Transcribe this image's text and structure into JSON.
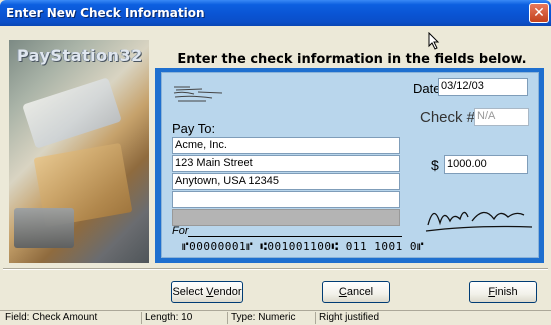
{
  "window": {
    "title": "Enter New Check Information",
    "close_glyph": "✕"
  },
  "branding": {
    "logo_text": "PayStation32"
  },
  "instruction": "Enter the check information in the fields below.",
  "check": {
    "date_label": "Date",
    "date_value": "03/12/03",
    "check_no_label": "Check #",
    "check_no_placeholder": "N/A",
    "pay_to_label": "Pay To:",
    "address_lines": [
      "Acme, Inc.",
      "123 Main Street",
      "Anytown, USA 12345",
      "",
      ""
    ],
    "dollar_sign": "$",
    "amount_value": "1000.00",
    "for_label": "For",
    "micr_line": "⑈00000001⑈ ⑆001001100⑆ 011 1001 0⑈"
  },
  "buttons": {
    "select_vendor": {
      "pre": "Select ",
      "accel": "V",
      "post": "endor"
    },
    "cancel": {
      "pre": "",
      "accel": "C",
      "post": "ancel"
    },
    "finish": {
      "pre": "",
      "accel": "F",
      "post": "inish"
    }
  },
  "status_bar": {
    "field": "Field: Check Amount",
    "length": "Length: 10",
    "type": "Type: Numeric",
    "justify": "Right justified"
  },
  "colors": {
    "title_bar": "#0a53d2",
    "check_background": "#b9d6ec",
    "check_border": "#1e6fcf",
    "window_face": "#ece9d8"
  },
  "icons": [
    "close-icon",
    "mouse-cursor-icon",
    "signature-icon"
  ]
}
